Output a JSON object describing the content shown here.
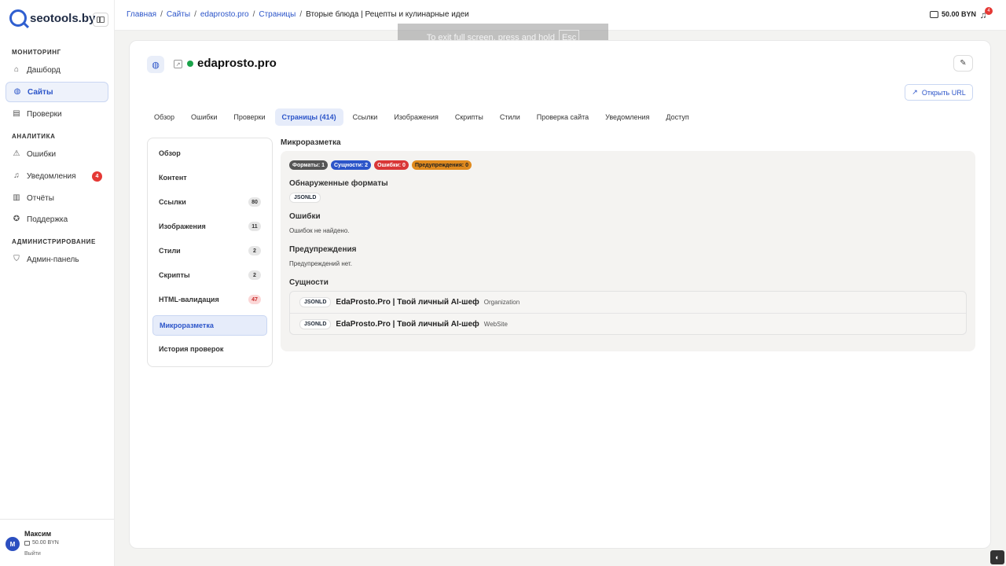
{
  "app": {
    "logo": "seotools.by"
  },
  "sidebar": {
    "sections": [
      {
        "title": "МОНИТОРИНГ"
      },
      {
        "title": "АНАЛИТИКА"
      },
      {
        "title": "АДМИНИСТРИРОВАНИЕ"
      }
    ],
    "items": [
      {
        "label": "Дашборд",
        "icon": "home-icon"
      },
      {
        "label": "Сайты",
        "icon": "globe-icon",
        "active": true
      },
      {
        "label": "Проверки",
        "icon": "clipboard-icon"
      },
      {
        "label": "Ошибки",
        "icon": "warning-icon"
      },
      {
        "label": "Уведомления",
        "icon": "bell-icon",
        "badge": "4"
      },
      {
        "label": "Отчёты",
        "icon": "document-icon"
      },
      {
        "label": "Поддержка",
        "icon": "lifebuoy-icon"
      },
      {
        "label": "Админ-панель",
        "icon": "shield-icon"
      }
    ],
    "user": {
      "initial": "М",
      "name": "Максим",
      "balance": "50.00 BYN",
      "logout": "Выйти"
    }
  },
  "topbar": {
    "breadcrumb": [
      "Главная",
      "Сайты",
      "edaprosto.pro",
      "Страницы"
    ],
    "current": "Вторые блюда | Рецепты и кулинарные идеи",
    "balance": "50.00 BYN",
    "notif_count": "4"
  },
  "toast": {
    "text": "To exit full screen, press and hold",
    "key": "Esc"
  },
  "site": {
    "title": "edaprosto.pro",
    "status_color": "#1aa34a",
    "open_url": "Открыть URL"
  },
  "tabs": [
    "Обзор",
    "Ошибки",
    "Проверки",
    "Страницы (414)",
    "Ссылки",
    "Изображения",
    "Скрипты",
    "Стили",
    "Проверка сайта",
    "Уведомления",
    "Доступ"
  ],
  "active_tab": "Страницы (414)",
  "subnav": [
    {
      "label": "Обзор"
    },
    {
      "label": "Контент"
    },
    {
      "label": "Ссылки",
      "count": "80"
    },
    {
      "label": "Изображения",
      "count": "11"
    },
    {
      "label": "Стили",
      "count": "2"
    },
    {
      "label": "Скрипты",
      "count": "2"
    },
    {
      "label": "HTML-валидация",
      "count": "47"
    },
    {
      "label": "Микроразметка",
      "active": true
    },
    {
      "label": "История проверок"
    }
  ],
  "microdata": {
    "heading": "Микроразметка",
    "chips": [
      "Форматы: 1",
      "Сущности: 2",
      "Ошибки: 0",
      "Предупреждения: 0"
    ],
    "formats_title": "Обнаруженные форматы",
    "format_tag": "JSONLD",
    "errors_title": "Ошибки",
    "errors_text": "Ошибок не найдено.",
    "warnings_title": "Предупреждения",
    "warnings_text": "Предупреждений нет.",
    "entities_title": "Сущности",
    "entities": [
      {
        "format": "JSONLD",
        "name": "EdaProsto.Pro | Твой личный AI-шеф",
        "type": "Organization"
      },
      {
        "format": "JSONLD",
        "name": "EdaProsto.Pro | Твой личный AI-шеф",
        "type": "WebSite"
      }
    ]
  },
  "colors": {
    "accent": "#2c55c9",
    "danger": "#d93737",
    "warning": "#e08a1e"
  }
}
